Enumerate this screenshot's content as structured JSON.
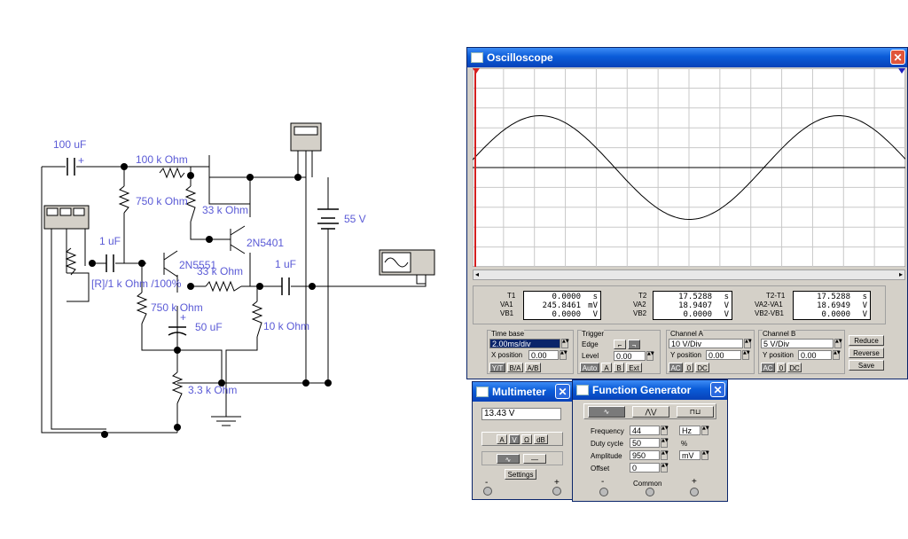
{
  "schematic": {
    "labels": {
      "c_in": "100 uF",
      "r_top": "100 k Ohm",
      "r_bias1": "750 k Ohm",
      "r_coll": "33 k Ohm",
      "q2": "2N5401",
      "c_mid": "1 uF",
      "q1": "2N5551",
      "r_fb": "33 k Ohm",
      "c_out": "1 uF",
      "pot": "[R]/1 k Ohm /100%",
      "r_bias2": "750 k Ohm",
      "c_emit": "50 uF",
      "r_load": "10 k Ohm",
      "r_emit": "3.3 k Ohm",
      "battery": "55 V",
      "plus": "+",
      "minus": "-"
    }
  },
  "oscilloscope": {
    "title": "Oscilloscope",
    "readouts": {
      "t1": {
        "name": "T1",
        "value": "0.0000",
        "unit": "s"
      },
      "va1": {
        "name": "VA1",
        "value": "245.8461",
        "unit": "mV"
      },
      "vb1": {
        "name": "VB1",
        "value": "0.0000",
        "unit": "V"
      },
      "t2": {
        "name": "T2",
        "value": "17.5288",
        "unit": "s"
      },
      "va2": {
        "name": "VA2",
        "value": "18.9407",
        "unit": "V"
      },
      "vb2": {
        "name": "VB2",
        "value": "0.0000",
        "unit": "V"
      },
      "t2t1": {
        "name": "T2-T1",
        "value": "17.5288",
        "unit": "s"
      },
      "va2va1": {
        "name": "VA2-VA1",
        "value": "18.6949",
        "unit": "V"
      },
      "vb2vb1": {
        "name": "VB2-VB1",
        "value": "0.0000",
        "unit": "V"
      }
    },
    "timebase": {
      "title": "Time base",
      "value": "2.00ms/div",
      "xpos_label": "X position",
      "xpos": "0.00",
      "modes": [
        "Y/T",
        "B/A",
        "A/B"
      ]
    },
    "trigger": {
      "title": "Trigger",
      "edge_label": "Edge",
      "level_label": "Level",
      "level": "0.00",
      "modes": [
        "Auto",
        "A",
        "B",
        "Ext"
      ]
    },
    "channel_a": {
      "title": "Channel A",
      "value": "10 V/Div",
      "ypos_label": "Y position",
      "ypos": "0.00",
      "coupling": [
        "AC",
        "0",
        "DC"
      ]
    },
    "channel_b": {
      "title": "Channel B",
      "value": "5 V/Div",
      "ypos_label": "Y position",
      "ypos": "0.00",
      "coupling": [
        "AC",
        "0",
        "DC"
      ]
    },
    "buttons": {
      "reduce": "Reduce",
      "reverse": "Reverse",
      "save": "Save"
    },
    "cursor_markers": {
      "left": "1",
      "right": "2"
    },
    "colors": {
      "cursor1": "#d42020",
      "cursor2": "#2020c0",
      "trace": "#000000",
      "grid": "#c8c8c8"
    }
  },
  "waveform": {
    "type": "line",
    "ylim": [
      -2,
      2
    ],
    "xlim": [
      0,
      10
    ],
    "cycles": 1.45,
    "phase_start": 0.15,
    "amplitude": 0.95
  },
  "multimeter": {
    "title": "Multimeter",
    "display": "13.43  V",
    "modes": [
      "A",
      "V",
      "Ω",
      "dB"
    ],
    "settings": "Settings",
    "minus": "-",
    "plus": "+"
  },
  "function_generator": {
    "title": "Function Generator",
    "frequency_label": "Frequency",
    "frequency": "44",
    "frequency_unit": "Hz",
    "duty_label": "Duty cycle",
    "duty": "50",
    "duty_unit": "%",
    "amplitude_label": "Amplitude",
    "amplitude": "950",
    "amplitude_unit": "mV",
    "offset_label": "Offset",
    "offset": "0",
    "common": "Common",
    "minus": "-",
    "plus": "+"
  }
}
